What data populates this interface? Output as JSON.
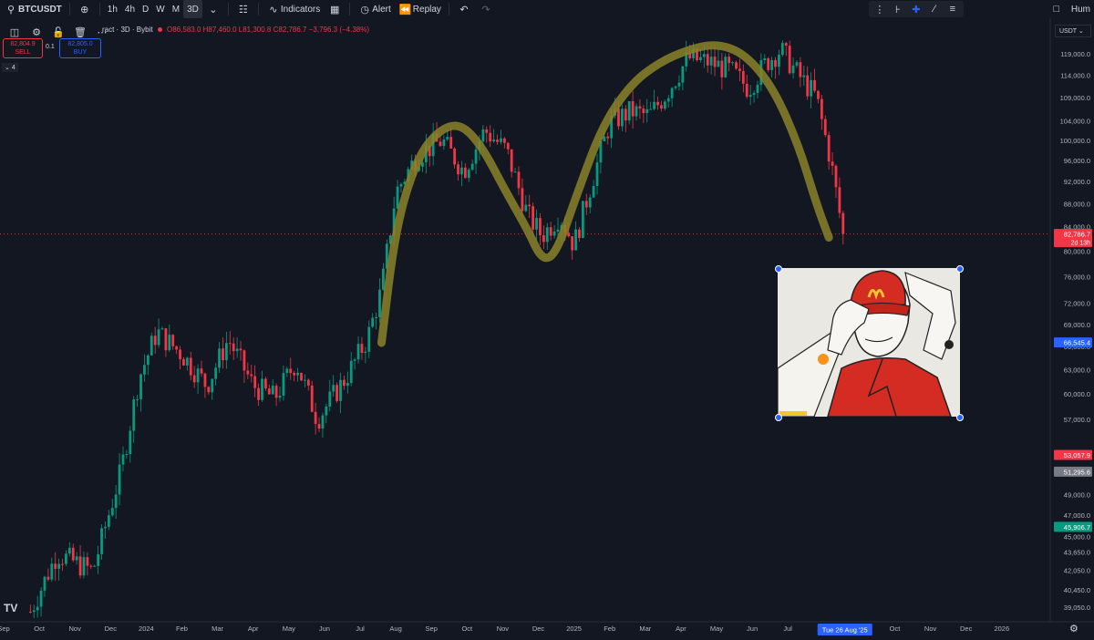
{
  "toolbar": {
    "symbol": "BTCUSDT",
    "intervals": [
      "1h",
      "4h",
      "D",
      "W",
      "M",
      "3D"
    ],
    "active_interval": "3D",
    "indicators_label": "Indicators",
    "alert_label": "Alert",
    "replay_label": "Replay",
    "right_label": "Hum"
  },
  "orders": {
    "sell_price": "82,804.9",
    "sell_label": "SELL",
    "qty": "0.1",
    "buy_price": "82,805.0",
    "buy_label": "BUY"
  },
  "legend": {
    "title_fragment": "ract · 3D · Bybit",
    "ohlc": "O86,583.0 H87,460.0 L81,300.8 C82,786.7 −3,796.3 (−4.38%)"
  },
  "collapse_label": "4",
  "currency": "USDT",
  "chart_data": {
    "type": "candlestick",
    "y_scale": "log",
    "ylim": [
      37500,
      125000
    ],
    "y_ticks": [
      {
        "value": 119000,
        "label": "119,000.0"
      },
      {
        "value": 114000,
        "label": "114,000.0"
      },
      {
        "value": 109000,
        "label": "109,000.0"
      },
      {
        "value": 104000,
        "label": "104,000.0"
      },
      {
        "value": 100000,
        "label": "100,000.0"
      },
      {
        "value": 96000,
        "label": "96,000.0"
      },
      {
        "value": 92000,
        "label": "92,000.0"
      },
      {
        "value": 88000,
        "label": "88,000.0"
      },
      {
        "value": 84000,
        "label": "84,000.0"
      },
      {
        "value": 80000,
        "label": "80,000.0"
      },
      {
        "value": 76000,
        "label": "76,000.0"
      },
      {
        "value": 72000,
        "label": "72,000.0"
      },
      {
        "value": 69000,
        "label": "69,000.0"
      },
      {
        "value": 66000,
        "label": "66,000.0"
      },
      {
        "value": 63000,
        "label": "63,000.0"
      },
      {
        "value": 60000,
        "label": "60,000.0"
      },
      {
        "value": 57000,
        "label": "57,000.0"
      },
      {
        "value": 53000,
        "label": "53,000.0"
      },
      {
        "value": 49000,
        "label": "49,000.0"
      },
      {
        "value": 47000,
        "label": "47,000.0"
      },
      {
        "value": 45000,
        "label": "45,000.0"
      },
      {
        "value": 43650,
        "label": "43,650.0"
      },
      {
        "value": 42050,
        "label": "42,050.0"
      },
      {
        "value": 40450,
        "label": "40,450.0"
      },
      {
        "value": 39050,
        "label": "39,050.0"
      }
    ],
    "price_badges": [
      {
        "value": 82786.7,
        "label": "82,786.7",
        "sub": "2d 13h",
        "color": "#f23645"
      },
      {
        "value": 66545.4,
        "label": "66,545.4",
        "color": "#2962ff"
      },
      {
        "value": 53057.9,
        "label": "53,057.9",
        "color": "#f23645"
      },
      {
        "value": 51295.6,
        "label": "51,295.6",
        "color": "#787b86"
      },
      {
        "value": 45906.7,
        "label": "45,906.7",
        "color": "#089981"
      }
    ],
    "x_labels": [
      "Sep",
      "Oct",
      "Nov",
      "Dec",
      "2024",
      "Feb",
      "Mar",
      "Apr",
      "May",
      "Jun",
      "Jul",
      "Aug",
      "Sep",
      "Oct",
      "Nov",
      "Dec",
      "2025",
      "Feb",
      "Mar",
      "Apr",
      "May",
      "Jun",
      "Jul",
      "Aug",
      "Sep",
      "Oct",
      "Nov",
      "Dec",
      "2026"
    ],
    "crosshair_date": "Tue 26 Aug '25",
    "up_color": "#089981",
    "down_color": "#f23645",
    "pattern_color": "#8a8328",
    "price_anchors": [
      {
        "t": 0.75,
        "p": 38700
      },
      {
        "t": 1.5,
        "p": 43500
      },
      {
        "t": 2.5,
        "p": 42000
      },
      {
        "t": 3.3,
        "p": 51500
      },
      {
        "t": 3.8,
        "p": 62000
      },
      {
        "t": 4.3,
        "p": 68000
      },
      {
        "t": 5.0,
        "p": 65000
      },
      {
        "t": 5.7,
        "p": 61000
      },
      {
        "t": 6.3,
        "p": 67000
      },
      {
        "t": 7.0,
        "p": 61000
      },
      {
        "t": 7.6,
        "p": 59500
      },
      {
        "t": 8.2,
        "p": 64000
      },
      {
        "t": 8.8,
        "p": 57000
      },
      {
        "t": 9.6,
        "p": 62000
      },
      {
        "t": 10.2,
        "p": 67000
      },
      {
        "t": 10.6,
        "p": 74000
      },
      {
        "t": 11.0,
        "p": 90000
      },
      {
        "t": 11.6,
        "p": 97000
      },
      {
        "t": 12.3,
        "p": 100000
      },
      {
        "t": 12.9,
        "p": 94000
      },
      {
        "t": 13.5,
        "p": 102000
      },
      {
        "t": 14.1,
        "p": 98000
      },
      {
        "t": 14.7,
        "p": 86000
      },
      {
        "t": 15.1,
        "p": 82500
      },
      {
        "t": 15.6,
        "p": 86000
      },
      {
        "t": 16.0,
        "p": 81000
      },
      {
        "t": 16.5,
        "p": 92000
      },
      {
        "t": 17.0,
        "p": 103500
      },
      {
        "t": 17.6,
        "p": 106000
      },
      {
        "t": 18.1,
        "p": 105000
      },
      {
        "t": 18.6,
        "p": 110000
      },
      {
        "t": 19.2,
        "p": 118000
      },
      {
        "t": 19.8,
        "p": 117000
      },
      {
        "t": 20.4,
        "p": 115000
      },
      {
        "t": 20.9,
        "p": 111000
      },
      {
        "t": 21.4,
        "p": 117000
      },
      {
        "t": 21.8,
        "p": 120000
      },
      {
        "t": 22.3,
        "p": 114000
      },
      {
        "t": 22.8,
        "p": 109000
      },
      {
        "t": 23.2,
        "p": 96000
      },
      {
        "t": 23.55,
        "p": 82786.7
      }
    ],
    "pattern_curve": [
      {
        "t": 10.6,
        "p": 66500
      },
      {
        "t": 11.0,
        "p": 84000
      },
      {
        "t": 11.6,
        "p": 96500
      },
      {
        "t": 12.2,
        "p": 102000
      },
      {
        "t": 12.8,
        "p": 103500
      },
      {
        "t": 13.4,
        "p": 99000
      },
      {
        "t": 14.1,
        "p": 90000
      },
      {
        "t": 14.7,
        "p": 83500
      },
      {
        "t": 15.1,
        "p": 78500
      },
      {
        "t": 15.5,
        "p": 79500
      },
      {
        "t": 16.1,
        "p": 90000
      },
      {
        "t": 16.8,
        "p": 103000
      },
      {
        "t": 17.6,
        "p": 112000
      },
      {
        "t": 18.4,
        "p": 117000
      },
      {
        "t": 19.2,
        "p": 120000
      },
      {
        "t": 20.0,
        "p": 121500
      },
      {
        "t": 20.8,
        "p": 119000
      },
      {
        "t": 21.6,
        "p": 111000
      },
      {
        "t": 22.3,
        "p": 99000
      },
      {
        "t": 22.8,
        "p": 88000
      },
      {
        "t": 23.15,
        "p": 82200
      }
    ]
  }
}
